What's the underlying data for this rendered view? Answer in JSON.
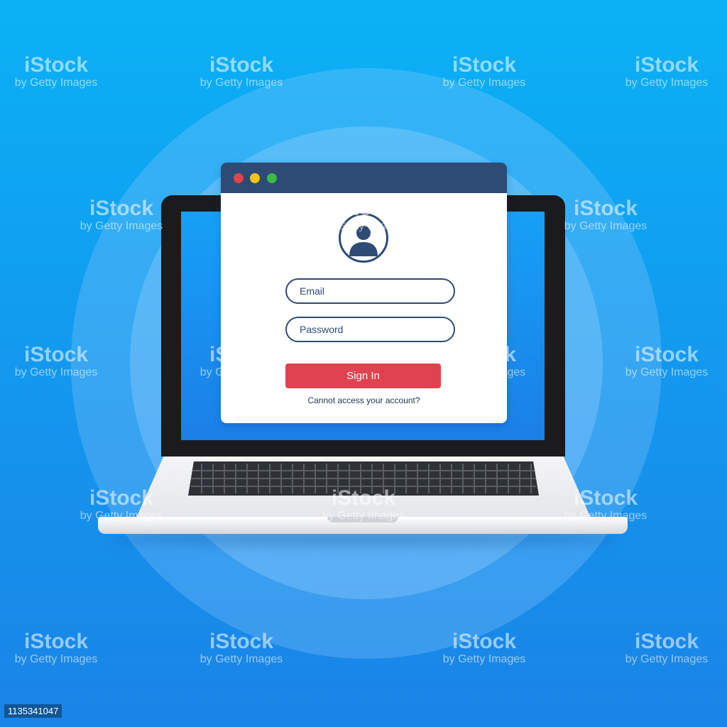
{
  "colors": {
    "background": "#1496ee",
    "titlebar": "#2d4b75",
    "accent_red": "#e0434f",
    "dot_red": "#e4424a",
    "dot_yellow": "#f5c514",
    "dot_green": "#3cba4a"
  },
  "icons": [
    "user-avatar-icon",
    "window-close-dot",
    "window-minimize-dot",
    "window-maximize-dot"
  ],
  "login": {
    "email_placeholder": "Email",
    "password_placeholder": "Password",
    "sign_in_label": "Sign In",
    "help_link": "Cannot access your account?"
  },
  "watermark": {
    "brand": "iStock",
    "byline": "by Getty Images"
  },
  "image_id": "1135341047"
}
